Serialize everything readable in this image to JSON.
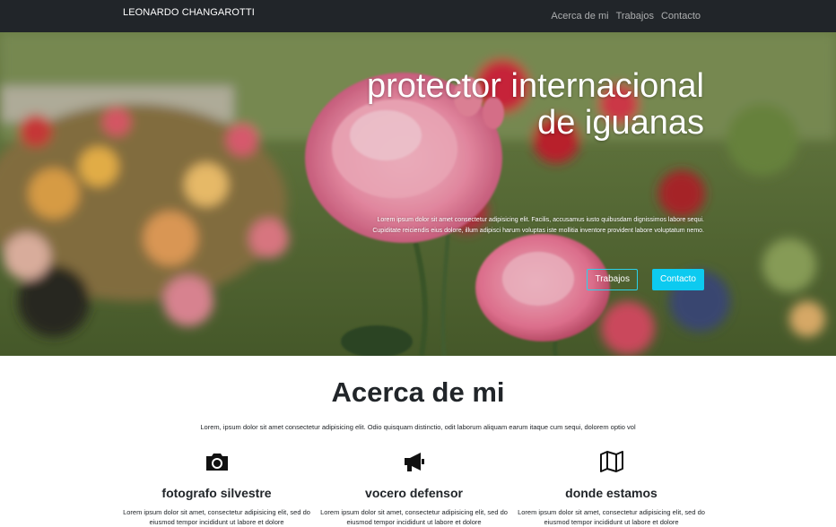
{
  "navbar": {
    "brand": "LEONARDO CHANGAROTTI",
    "links": [
      "Acerca de mi",
      "Trabajos",
      "Contacto"
    ]
  },
  "hero": {
    "title": "protector internacional de iguanas",
    "text": "Lorem ipsum dolor sit amet consectetur adipisicing elit. Facilis, accusamus iusto quibusdam dignissimos labore sequi. Cupiditate reiciendis eius dolore, illum adipisci harum voluptas iste mollitia inventore provident labore voluptatum nemo.",
    "buttons": [
      "Trabajos",
      "Contacto"
    ]
  },
  "about": {
    "title": "Acerca de mi",
    "text": "Lorem, ipsum dolor sit amet consectetur adipisicing elit. Odio quisquam distinctio, odit laborum aliquam earum itaque cum sequi, dolorem optio vol",
    "features": [
      {
        "icon": "camera-icon",
        "title": "fotografo silvestre",
        "text": "Lorem ipsum dolor sit amet, consectetur adipisicing elit, sed do eiusmod tempor incididunt ut labore et dolore"
      },
      {
        "icon": "megaphone-icon",
        "title": "vocero defensor",
        "text": "Lorem ipsum dolor sit amet, consectetur adipisicing elit, sed do eiusmod tempor incididunt ut labore et dolore"
      },
      {
        "icon": "map-icon",
        "title": "donde estamos",
        "text": "Lorem ipsum dolor sit amet, consectetur adipisicing elit, sed do eiusmod tempor incididunt ut labore et dolore"
      }
    ]
  },
  "colors": {
    "navbar": "#212529",
    "accent": "#0dcaf0",
    "text": "#212529"
  }
}
